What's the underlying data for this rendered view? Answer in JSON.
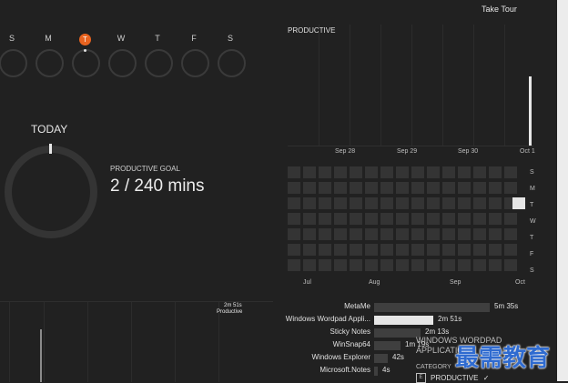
{
  "header": {
    "take_tour": "Take Tour"
  },
  "week": {
    "days": [
      "S",
      "M",
      "T",
      "W",
      "T",
      "F",
      "S"
    ],
    "today_index": 2
  },
  "today": {
    "title": "TODAY",
    "goal_label": "PRODUCTIVE GOAL",
    "goal_value": "2 / 240 mins",
    "progress_fraction": 0.008
  },
  "timeline": {
    "annotation_time": "2m 51s",
    "annotation_label": "Productive"
  },
  "productive_chart": {
    "title": "PRODUCTIVE",
    "x_labels": [
      "Sep 28",
      "Sep 29",
      "Sep 30",
      "Oct 1"
    ]
  },
  "heatmap": {
    "week_labels": [
      "S",
      "M",
      "T",
      "W",
      "T",
      "F",
      "S"
    ],
    "month_labels": [
      "Jul",
      "Aug",
      "Sep",
      "Oct"
    ]
  },
  "apps": [
    {
      "name": "MetaMe",
      "time": "5m 35s",
      "fraction": 1.0,
      "highlight": false
    },
    {
      "name": "Windows Wordpad Appli...",
      "time": "2m 51s",
      "fraction": 0.51,
      "highlight": true
    },
    {
      "name": "Sticky Notes",
      "time": "2m 13s",
      "fraction": 0.4,
      "highlight": false
    },
    {
      "name": "WinSnap64",
      "time": "1m 19s",
      "fraction": 0.23,
      "highlight": false
    },
    {
      "name": "Windows Explorer",
      "time": "42s",
      "fraction": 0.12,
      "highlight": false
    },
    {
      "name": "Microsoft.Notes",
      "time": "4s",
      "fraction": 0.03,
      "highlight": false
    }
  ],
  "detail_panel": {
    "title": "WINDOWS WORDPAD APPLICATION",
    "category_label": "CATEGORY",
    "category_key": "E",
    "category_value": "PRODUCTIVE"
  },
  "watermark": {
    "text": "最需教育"
  },
  "colors": {
    "accent": "#e8631f",
    "background": "#212121",
    "highlight_bar": "#e6e6e6"
  }
}
